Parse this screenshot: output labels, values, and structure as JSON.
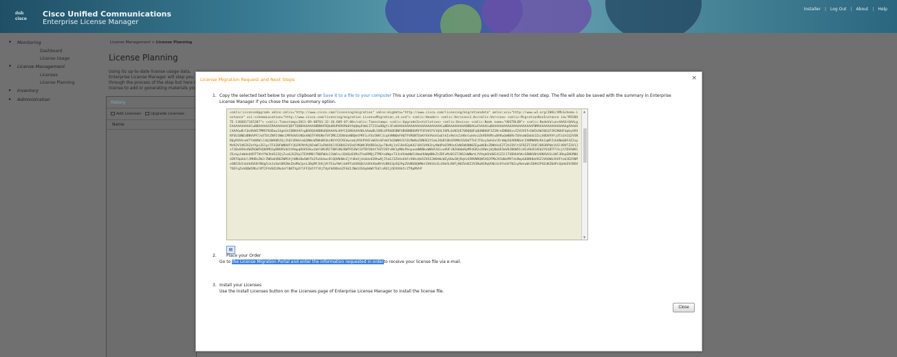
{
  "header": {
    "brand_small": "cisco",
    "brand_line1": "Cisco Unified Communications",
    "brand_line2": "Enterprise License Manager",
    "top_links": [
      "Installer",
      "Log Out",
      "About",
      "Help"
    ]
  },
  "sidebar": {
    "groups": [
      {
        "label": "Monitoring",
        "items": [
          "Dashboard",
          "License Usage"
        ]
      },
      {
        "label": "License Management",
        "items": [
          "Licenses",
          "License Planning"
        ]
      },
      {
        "label": "Inventory",
        "items": []
      },
      {
        "label": "Administration",
        "items": []
      }
    ]
  },
  "main": {
    "breadcrumb_parent": "License Management",
    "breadcrumb_current": "License Planning",
    "page_title": "License Planning",
    "intro": "Using its up-to-date license usage data, Enterprise License Manager will step you through the process of the step but here more license to add or generating materials you w",
    "history": {
      "title": "History",
      "add_licenses": "Add Licenses",
      "upgrade_licenses": "Upgrade Licenses",
      "column_name": "Name"
    }
  },
  "modal": {
    "title": "License Migration Request and Next Steps",
    "close_icon": "×",
    "step1": {
      "num": "1.",
      "text_before": "Copy the selected text below to your clipboard or",
      "link": "Save it to a file to your computer",
      "text_after": "This a your License Migration Request and you will need it for the next step. The file will also be saved with the summary in Enterprise License Manager if you chose the save summary option."
    },
    "request_xml": "<cmlic:LicenseUpgrade xmlns:cmlic=\"http://www.cisco.com/licensing/migration\" xmlns:migdata=\"http://www.cisco.com/licensing/migrationdata\" xmlns:xsi=\"http://www.w3.org/2001/XMLSchema-instance\" xsi:schemaLocation=\"http://www.cisco.com/licensing/migration LicenseMigration_v4.xsd\"> <cmlic:Header> <cmlic:Version>1.0</cmlic:Version> <cmlic:MigrationRunInstance id=\"MIGRATE-1366817165387\"> <cmlic:Timestamp>2011-09-08T01:32:10.609-07:00</cmlic:Timestamp> <cmlic:UpgradeInstallation> <cmlic:Device> <cmlic:Node name=\"HOSTBLOB\"> <cmlic:NodeValue>AAAGrQAALgEAAAAAAAAAACwBBAAAAAAIRAAAAAkACQDfTQ8BAAAAAAABBNAFRQbdKUPGRVRb0t9qQmpPaWiIT21GaOBgYi3FaKAAAAAAAAAAAAAAAAAAAAAAACwBBAAAAAAAAABBDAGaFAAAACwBAAAAAAAAAAAAAAAAAAAAAFNMAAAAAAAAAAAAAAkgAAAAACAAAGwBrC0vBVWI7MMSTKODawI4gm1kCDBKAAFngBGRQAABBKdQ0AAAALAHYCQ1NSAAAABLAAdwBL5ORLUFR60EBNFUBUBNBQVRFP3FUVIFV1QXL5ORLQzNIUE70BQQ0FqQUNBUUF3Z2NreENBQUxvZ2V2VEFnSWIkUWJ0Q1F2R2NUUFdpbyUVVRFUU1BNEdBNVVPClk4TUtZNFEtNWc1MFRdVGtNQnhNQTFVRUNnTVFZMEJ2ENXdnNBQmtPRF1uYXo5NVl3iqhVNNQkFHQTFVRUNTUoKYXhVVohIwEtkIx9mlkIzH8nlwhAnzZk9ERVRtuBARuQmNURnTUhhaWZmbUJZajhBQVVVYjdTa1hCQ2VSNDQyRXVhcmVTYmNXWlJiWjBWV0RJQjJhQlVDUmlmQ3NWcW5Nb0R3bzNSYXZCREdwcmdjRVhPVXFvWGVvUFdmYXd2WW9JSlBiMmNaZUNHS2t5akJXbDlBbXFKMHJSV0dTTkFJT0sySmhXalRrbWp5UXRKNGdrZXNMWUNzRk1qWFZzbGNmQ0F4Z2xpMzR2V1VKZXZaYXpvZGlpcTFXZ0FWN0VFY3Q2RFNtRjNZeWFIaFN4OVJlR3BHS2VIbUlMQWVJRXRDSmJpcTNvNjJnSlBnR2pKd2l0V1VXK1hyVWdPaG5MUzd2dW1WU0N0ZEpwWXBsZDNhUzE2T2hIOVltSFRZZTJXUFJ0R3RPUm1VSlVDVTZZV1JsY1BaVHVoVWZKQWFUQ0VMQ1pDNVRSdU1tRmpqRUVSVkw1bHl0K3RCT0NlOWJBWTR5ZWt1VTBYOUdtTHZYZHYvNVJpMWxPbnpuemNKNkxWWVA2b1cwVUFiN2U0dmRpMFdGR2xOVWxjWjNmUE5mV0JNOW5IcHIzRkR1VE02Y01BTFY3cjhTOVA0K1ZSckpJeWdnUXRTTVhYYWJkVG1IQjZvaGJGZVp1TEVUM0lTN0FWUzJJbWlnc3Q4QzB1MzZYakRMQjZTMEtaOWpzT3JnVVdmNWJiNmd4UWpNNkZtZDFxMzBCSTJNS2dWNmtLYVVqdGhHUE41Z3l1TXBVbVhKcGRWN1NtUUNXVU1LVWl3RkpENGM0UUZKT0pUdzlJMHBzZWJrZWRabVB6ZWM1VjhNNzBwSWhTb2FwSkhwc0lQQVN4WnZjYnBaVjdvbUxOZ0hwRjI5aEJ3ZkVuUkFsV0kzQm5ZVXZJWUhWcWZyOUw2WjRqVzU5NVNRQW5XQ2FMb2V3dWxMVTdxRmpGbDNHbk9GZ1V6UWk3VUFtaUJDZXNPeGN5Zk5sbXh0VUhYNUg5ck1nSmt0R2NnZkdMa1pnL3BqMFJUVjVhTG1wYWtibHFFaGhRQ0JzUXhXbmRtVzBHS3pSQ29pZVdNS0Q0Mmt3V0tUcEc4Vm5LRHFjNUZVdUI2V3RwN1RqVGNiUzVYeGhTN2xyRmtwWnI0VHJPSEdKZ0dPcVpHeE9JNXVTOEFqZnhBQW1MbzlMT2FhV0ZLMmJmYlNOTXpEYlFFZm5YYlRjTVpFbENXeGZFbU1JNm1OSXp0dWtTbElnRU1jOEVUVk5rZTRpMVhP",
    "step2": {
      "num": "2.",
      "heading": "Place your Order",
      "go_to": "Go to",
      "highlighted": "the License Migration Portal and enter the information requested in order",
      "after": "to receive your license file via e-mail."
    },
    "step3": {
      "num": "3.",
      "heading": "Install your Licenses",
      "text": "Use the Install Licenses button on the Licenses page of Enterprise License Manager to install the license file."
    },
    "close_button": "Close"
  }
}
